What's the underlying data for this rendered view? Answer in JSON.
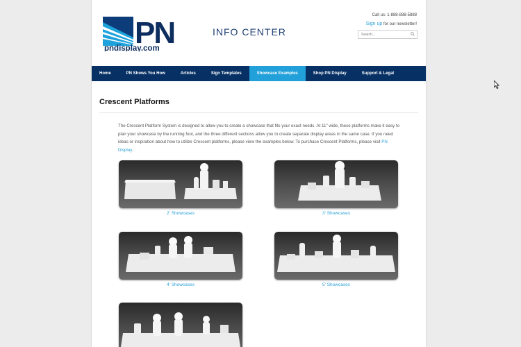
{
  "header": {
    "logo_text": "PN",
    "logo_domain": "pndisplay.com",
    "info_center": "INFO CENTER",
    "call_us": "Call us: 1-888-888-5888",
    "signup_link": "Sign up",
    "newsletter_text": " for our newsletter!",
    "search_placeholder": "Search..."
  },
  "nav": {
    "items": [
      {
        "label": "Home"
      },
      {
        "label": "PN Shows You How"
      },
      {
        "label": "Articles"
      },
      {
        "label": "Sign Templates"
      },
      {
        "label": "Showcase Examples"
      },
      {
        "label": "Shop PN Display"
      },
      {
        "label": "Support & Legal"
      }
    ],
    "active_index": 4
  },
  "main": {
    "title": "Crescent Platforms",
    "desc_main": "The Crescent Platform System is designed to allow you to create a showcase that fits your exact needs. At 11\" wide, these platforms make it easy to plan your showcase by the running foot, and the three different sections allow you to create separate display areas in the same case. If you need ideas or inspiration about how to utilize Crescent platforms, please view the examples below. To purchase Crescent Platforms, please visit ",
    "desc_link": "PN Display",
    "desc_end": ".",
    "showcases": [
      {
        "caption": "2' Showcases"
      },
      {
        "caption": "3' Showcases"
      },
      {
        "caption": "4' Showcases"
      },
      {
        "caption": "5' Showcases"
      }
    ]
  },
  "colors": {
    "nav_bg": "#073165",
    "nav_active": "#21a0da",
    "link": "#2aa0d8"
  }
}
